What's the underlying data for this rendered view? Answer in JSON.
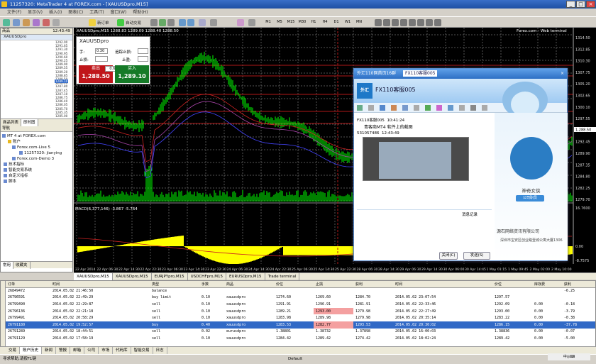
{
  "window": {
    "title": "11257320: MetaTrader 4 at FOREX.com - [XAUUSDpro,M15]"
  },
  "menu": [
    "文件(F)",
    "显示(V)",
    "插入(I)",
    "图表(C)",
    "工具(T)",
    "窗口(W)",
    "帮助(H)"
  ],
  "toolbar": {
    "new_order": "新订单",
    "auto_trade": "自动交易",
    "timeframes": [
      "M1",
      "M5",
      "M15",
      "M30",
      "H1",
      "H4",
      "D1",
      "W1",
      "MN"
    ]
  },
  "market_watch": {
    "header_symbol": "商品",
    "header_time": "12:43:49",
    "rows": [
      "XAUUSDpro"
    ],
    "prices": [
      "1292.00",
      "1291.65",
      "1291.30",
      "1290.95",
      "1290.60",
      "1290.25",
      "1289.90",
      "1289.55",
      "1289.20",
      "1288.85",
      "1288.50",
      "1288.15",
      "1287.80",
      "1287.45",
      "1287.10",
      "1286.75",
      "1286.40",
      "1286.05",
      "1285.70",
      "1285.35",
      "1285.00"
    ],
    "highlight": "1289.10",
    "tabs": [
      "商品列表",
      "即时图"
    ]
  },
  "navigator": {
    "title": "导航",
    "items": [
      "MT 4 at FOREX.com",
      "账户",
      "Forex.com-Live 5",
      "11257320: jianying",
      "Forex.com-Demo 3",
      "技术指标",
      "智能交易系统",
      "自定义指标",
      "脚本"
    ],
    "tabs": [
      "常用",
      "收藏夹"
    ]
  },
  "trade_panel": {
    "symbol": "XAUUSDpro",
    "lot_label": "手:",
    "lot": "0.30",
    "trail_label": "追踪止损:",
    "stoploss_label": "止损:",
    "takeprofit_label": "止盈:",
    "spread": "0.60",
    "sell_label": "卖出",
    "buy_label": "买入",
    "sell_price": "1,288.50",
    "buy_price": "1,289.10"
  },
  "chart": {
    "info": "XAUUSDpro,M15  1288.83 1289.09 1288.40 1288.50",
    "macd_label": "MACD(6,377,146) -3.867 -5.764",
    "broker": "Forex.com - Web terminal",
    "price_axis": [
      "1314.50",
      "1312.85",
      "1310.30",
      "1307.75",
      "1305.20",
      "1302.65",
      "1300.10",
      "1297.55",
      "1295.00",
      "1292.45",
      "1289.90",
      "1287.35",
      "1284.80",
      "1282.25",
      "1279.70"
    ],
    "macd_axis": [
      "16.7600",
      "0.00",
      "-8.7575"
    ],
    "time_axis": [
      "22 Apr 2014",
      "22 Apr 06:30",
      "22 Apr 14:30",
      "22 Apr 22:30",
      "23 Apr 06:30",
      "23 Apr 14:30",
      "23 Apr 22:30",
      "24 Apr 06:30",
      "24 Apr 14:30",
      "24 Apr 22:30",
      "25 Apr 06:30",
      "25 Apr 14:30",
      "25 Apr 22:30",
      "28 Apr 06:30",
      "28 Apr 14:30",
      "29 Apr 06:30",
      "29 Apr 14:30",
      "30 Apr 06:00",
      "30 Apr 14:45",
      "1 May 01:15",
      "1 May 09:45",
      "2 May 02:00",
      "2 May 10:00"
    ],
    "tabs": [
      "XAUUSDpro,M15",
      "XAUUSDpro,M15",
      "EURJPYpro,M15",
      "USDCHFpro,M15",
      "EURUSDpro,M15",
      "Trade terminal"
    ]
  },
  "qq": {
    "title": "外汇110网首页16群",
    "tab": "FX110客服005",
    "name": "FX110客服005",
    "msg_sender": "FX110客服005",
    "msg_time": "10:41:24",
    "msg_text": "青客商MT4 软件上的截图",
    "msg2_id": "531057486",
    "msg2_time": "12:43:49",
    "history": "消息记录",
    "close_btn": "关闭(C)",
    "send_btn": "发送(S)",
    "contact_name": "神奇女侠",
    "contact_badge": "公司职员",
    "company": "源石网络资讯有限公司",
    "address": "深圳市宝安区创业路壹城公寓大厦1306"
  },
  "terminal": {
    "headers": [
      "订单",
      "时间",
      "类型",
      "手数",
      "商品",
      "价位",
      "止损",
      "获利",
      "时间",
      "价位",
      "库存费",
      "获利"
    ],
    "rows": [
      [
        "26849472",
        "2014.05.02 21:46:50",
        "balance",
        "",
        "",
        "",
        "",
        "",
        "",
        "",
        "",
        "-6.25"
      ],
      [
        "26796591",
        "2014.05.02 22:49:29",
        "buy limit",
        "0.10",
        "xauusdpro",
        "1274.60",
        "1269.60",
        "1284.70",
        "2014.05.02 23:07:54",
        "1297.57",
        "",
        ""
      ],
      [
        "26799490",
        "2014.05.02 22:29:87",
        "sell",
        "0.10",
        "xauusdpro",
        "1291.91",
        "1296.91",
        "1281.91",
        "2014.05.02 22:33:46",
        "1292.09",
        "0.00",
        "-0.18"
      ],
      [
        "26796136",
        "2014.05.02 22:21:18",
        "sell",
        "0.10",
        "xauusdpro",
        "1289.21",
        "1293.00",
        "1279.98",
        "2014.05.02 22:27:49",
        "1293.00",
        "0.00",
        "-3.79"
      ],
      [
        "26799491",
        "2014.05.02 20:58:29",
        "sell",
        "0.10",
        "xauusdpro",
        "1283.98",
        "1289.98",
        "1279.98",
        "2014.05.02 20:35:14",
        "1283.22",
        "0.00",
        "-0.38"
      ],
      [
        "26791180",
        "2014.05.02 19:52:57",
        "buy",
        "0.40",
        "xauusdpro",
        "1283.53",
        "1282.77",
        "1293.53",
        "2014.05.02 20:30:02",
        "1286.15",
        "0.00",
        "-37.78"
      ],
      [
        "26791289",
        "2014.05.02 18:44:51",
        "sell",
        "0.02",
        "eurusdpro",
        "1.38801",
        "1.38732",
        "1.37898",
        "2014.05.02 16:00:03",
        "1.38836",
        "0.00",
        "-0.07"
      ],
      [
        "26791129",
        "2014.05.02 17:58:19",
        "sell",
        "0.10",
        "xauusdpro",
        "1284.42",
        "1289.42",
        "1274.42",
        "2014.05.02 18:02:24",
        "1289.42",
        "0.00",
        "-5.00"
      ]
    ],
    "tabs": [
      "交易",
      "账户历史",
      "新闻",
      "警报",
      "邮箱",
      "公司",
      "市场",
      "代码库",
      "智能交易",
      "日志"
    ]
  },
  "status": {
    "left": "寻求帮助,请按F1键",
    "profile": "Default",
    "mem": "11/2 kb"
  },
  "colors": {
    "candle_up": "#00ff00",
    "candle_down": "#00ff00",
    "macd_fill": "#ffff00",
    "ma_red": "#cc2222",
    "ma_blue": "#4444ff",
    "sell": "#c0161a",
    "buy": "#157a27",
    "selected_row": "#3169c6"
  }
}
